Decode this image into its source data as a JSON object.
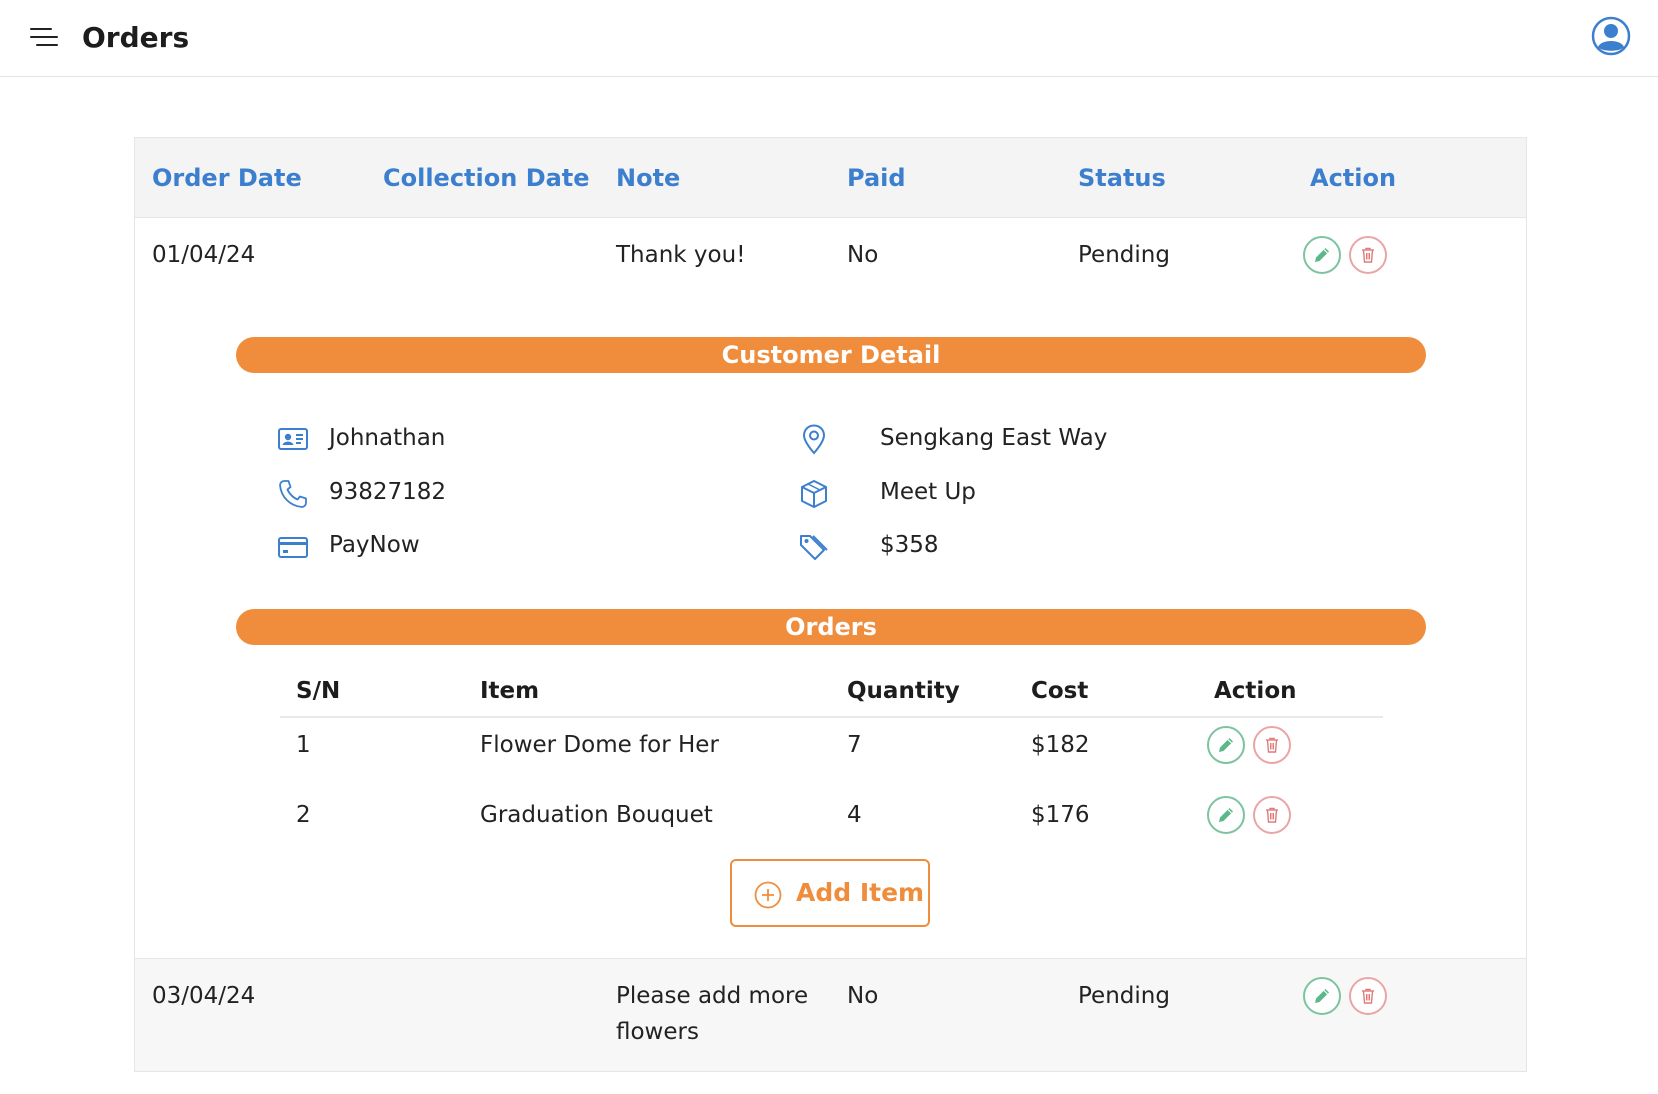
{
  "header": {
    "title": "Orders"
  },
  "table": {
    "columns": [
      "Order Date",
      "Collection Date",
      "Note",
      "Paid",
      "Status",
      "Action"
    ],
    "rows": [
      {
        "order_date": "01/04/24",
        "collection_date": "",
        "note": "Thank you!",
        "paid": "No",
        "status": "Pending"
      },
      {
        "order_date": "03/04/24",
        "collection_date": "",
        "note_line1": "Please add more",
        "note_line2": "flowers",
        "paid": "No",
        "status": "Pending"
      }
    ]
  },
  "customer_detail": {
    "heading": "Customer Detail",
    "name": "Johnathan",
    "phone": "93827182",
    "payment": "PayNow",
    "address": "Sengkang East Way",
    "delivery": "Meet Up",
    "total": "$358"
  },
  "items": {
    "heading": "Orders",
    "columns": [
      "S/N",
      "Item",
      "Quantity",
      "Cost",
      "Action"
    ],
    "rows": [
      {
        "sn": "1",
        "item": "Flower Dome for Her",
        "quantity": "7",
        "cost": "$182"
      },
      {
        "sn": "2",
        "item": "Graduation Bouquet",
        "quantity": "4",
        "cost": "$176"
      }
    ],
    "add_label": "Add Item"
  },
  "icons": {
    "menu": "menu-icon",
    "profile": "user-circle-icon",
    "edit": "pencil-icon",
    "delete": "trash-icon",
    "name": "id-card-icon",
    "phone": "phone-icon",
    "payment": "credit-card-icon",
    "address": "map-pin-icon",
    "delivery": "box-icon",
    "total": "price-tag-icon",
    "add": "plus-circle-icon"
  },
  "colors": {
    "accent_blue": "#3d7fcf",
    "accent_orange": "#f08d3c",
    "edit_green": "#5cb88a",
    "delete_red": "#e07a7a"
  }
}
